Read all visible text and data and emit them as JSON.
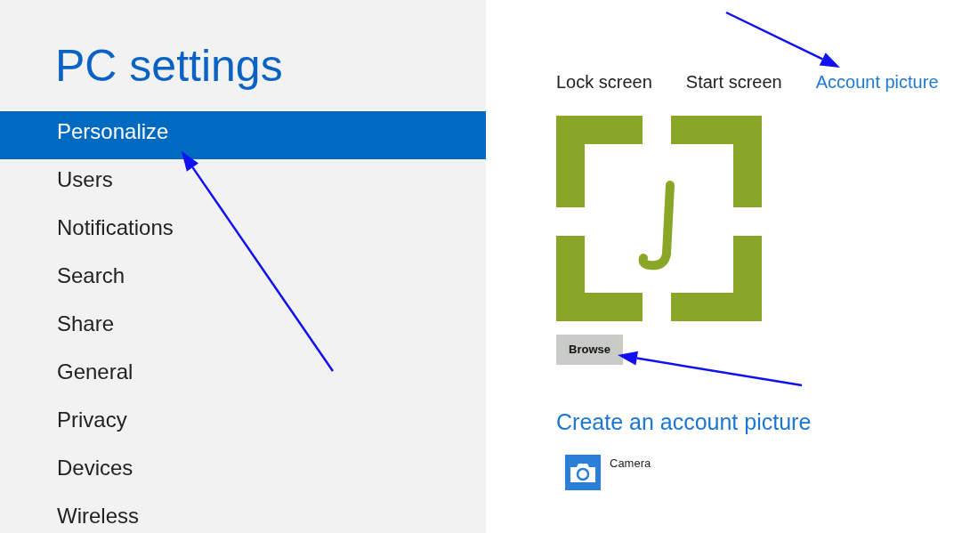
{
  "sidebar": {
    "title": "PC settings",
    "items": [
      {
        "label": "Personalize",
        "selected": true
      },
      {
        "label": "Users",
        "selected": false
      },
      {
        "label": "Notifications",
        "selected": false
      },
      {
        "label": "Search",
        "selected": false
      },
      {
        "label": "Share",
        "selected": false
      },
      {
        "label": "General",
        "selected": false
      },
      {
        "label": "Privacy",
        "selected": false
      },
      {
        "label": "Devices",
        "selected": false
      },
      {
        "label": "Wireless",
        "selected": false
      }
    ]
  },
  "tabs": [
    {
      "label": "Lock screen",
      "selected": false
    },
    {
      "label": "Start screen",
      "selected": false
    },
    {
      "label": "Account picture",
      "selected": true
    }
  ],
  "account_picture": {
    "browse_button": "Browse"
  },
  "create_section": {
    "heading": "Create an account picture",
    "apps": [
      {
        "label": "Camera"
      }
    ]
  }
}
